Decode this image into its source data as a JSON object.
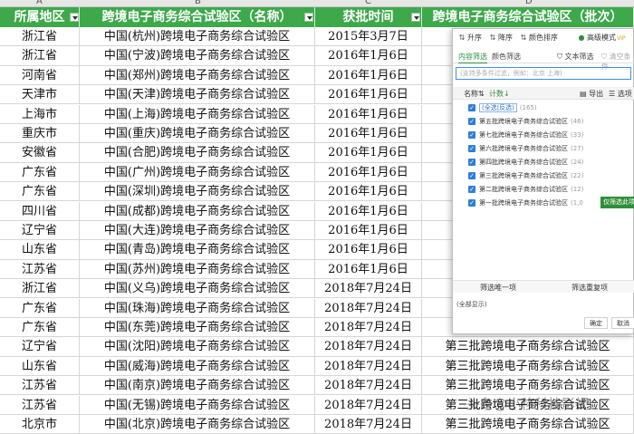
{
  "columns": {
    "letters": [
      "A",
      "B",
      "C",
      "D"
    ],
    "headers": [
      "所属地区",
      "跨境电子商务综合试验区（名称）",
      "获批时间",
      "跨境电子商务综合试验区（批次）"
    ]
  },
  "rows": [
    {
      "region": "浙江省",
      "name": "中国(杭州)跨境电子商务综合试验区",
      "date": "2015年3月7日",
      "batch": ""
    },
    {
      "region": "浙江省",
      "name": "中国(宁波)跨境电子商务综合试验区",
      "date": "2016年1月6日",
      "batch": ""
    },
    {
      "region": "河南省",
      "name": "中国(郑州)跨境电子商务综合试验区",
      "date": "2016年1月6日",
      "batch": ""
    },
    {
      "region": "天津市",
      "name": "中国(天津)跨境电子商务综合试验区",
      "date": "2016年1月6日",
      "batch": ""
    },
    {
      "region": "上海市",
      "name": "中国(上海)跨境电子商务综合试验区",
      "date": "2016年1月6日",
      "batch": ""
    },
    {
      "region": "重庆市",
      "name": "中国(重庆)跨境电子商务综合试验区",
      "date": "2016年1月6日",
      "batch": ""
    },
    {
      "region": "安徽省",
      "name": "中国(合肥)跨境电子商务综合试验区",
      "date": "2016年1月6日",
      "batch": ""
    },
    {
      "region": "广东省",
      "name": "中国(广州)跨境电子商务综合试验区",
      "date": "2016年1月6日",
      "batch": ""
    },
    {
      "region": "广东省",
      "name": "中国(深圳)跨境电子商务综合试验区",
      "date": "2016年1月6日",
      "batch": ""
    },
    {
      "region": "四川省",
      "name": "中国(成都)跨境电子商务综合试验区",
      "date": "2016年1月6日",
      "batch": ""
    },
    {
      "region": "辽宁省",
      "name": "中国(大连)跨境电子商务综合试验区",
      "date": "2016年1月6日",
      "batch": ""
    },
    {
      "region": "山东省",
      "name": "中国(青岛)跨境电子商务综合试验区",
      "date": "2016年1月6日",
      "batch": ""
    },
    {
      "region": "江苏省",
      "name": "中国(苏州)跨境电子商务综合试验区",
      "date": "2016年1月6日",
      "batch": ""
    },
    {
      "region": "浙江省",
      "name": "中国(义乌)跨境电子商务综合试验区",
      "date": "2018年7月24日",
      "batch": ""
    },
    {
      "region": "广东省",
      "name": "中国(珠海)跨境电子商务综合试验区",
      "date": "2018年7月24日",
      "batch": ""
    },
    {
      "region": "广东省",
      "name": "中国(东莞)跨境电子商务综合试验区",
      "date": "2018年7月24日",
      "batch": ""
    },
    {
      "region": "辽宁省",
      "name": "中国(沈阳)跨境电子商务综合试验区",
      "date": "2018年7月24日",
      "batch": "第三批跨境电子商务综合试验区"
    },
    {
      "region": "山东省",
      "name": "中国(威海)跨境电子商务综合试验区",
      "date": "2018年7月24日",
      "batch": "第三批跨境电子商务综合试验区"
    },
    {
      "region": "江苏省",
      "name": "中国(南京)跨境电子商务综合试验区",
      "date": "2018年7月24日",
      "batch": "第三批跨境电子商务综合试验区"
    },
    {
      "region": "江苏省",
      "name": "中国(无锡)跨境电子商务综合试验区",
      "date": "2018年7月24日",
      "batch": "第三批跨境电子商务综合试验区"
    },
    {
      "region": "北京市",
      "name": "中国(北京)跨境电子商务综合试验区",
      "date": "2018年7月24日",
      "batch": "第三批跨境电子商务综合试验区"
    }
  ],
  "filter": {
    "toolbar": {
      "asc": "升序",
      "desc": "降序",
      "color_sort": "颜色排序",
      "advanced": "高级模式",
      "advanced_badge": "VIP"
    },
    "tabs": {
      "content": "内容筛选",
      "color": "颜色筛选",
      "text": "文本筛选",
      "clear": "清空条件"
    },
    "search_placeholder": "(支持多条件过滤，例如：北京  上海)",
    "list_header": {
      "name": "名称",
      "count": "计数",
      "export": "导出",
      "options": "选项"
    },
    "select_all": {
      "label": "(全选|反选)",
      "count": "(165)"
    },
    "items": [
      {
        "label": "第五批跨境电子商务综合试验区",
        "count": "(46)"
      },
      {
        "label": "第七批跨境电子商务综合试验区",
        "count": "(33)"
      },
      {
        "label": "第六批跨境电子商务综合试验区",
        "count": "(27)"
      },
      {
        "label": "第四批跨境电子商务综合试验区",
        "count": "(24)"
      },
      {
        "label": "第三批跨境电子商务综合试验区",
        "count": "(22)"
      },
      {
        "label": "第二批跨境电子商务综合试验区",
        "count": "(12)"
      },
      {
        "label": "第一批跨境电子商务综合试验区",
        "count": "(1,0"
      }
    ],
    "only_button": "仅筛选此项",
    "footer": {
      "unique": "筛选唯一项",
      "duplicate": "筛选重复项"
    },
    "status": "(全部显示)",
    "ok": "确定",
    "cancel": "取消"
  },
  "watermark": "头条@小移科技影视",
  "colors": {
    "header_green": "#3da94a",
    "accent_green": "#2f8f3a",
    "checkbox_blue": "#2f7fd6"
  }
}
